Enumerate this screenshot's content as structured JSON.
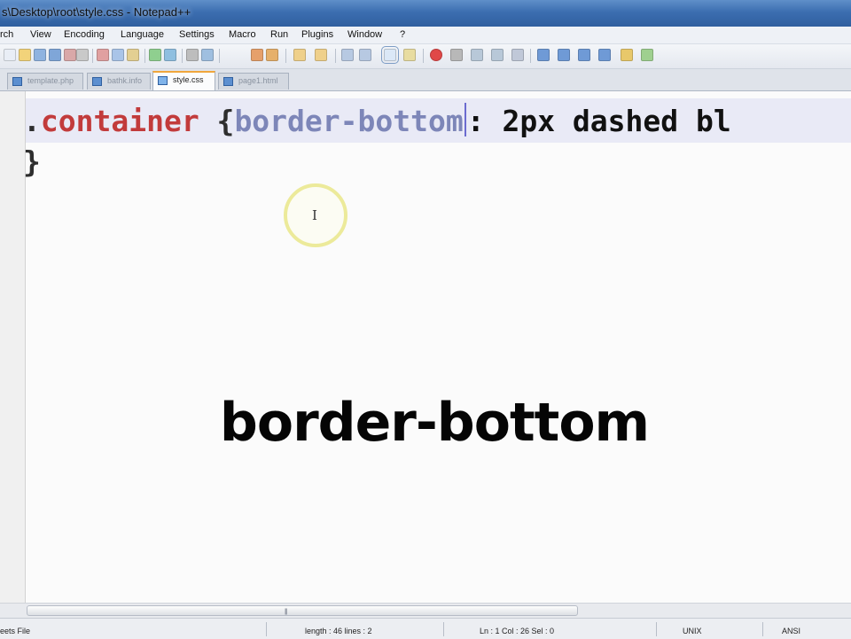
{
  "window": {
    "title": "s\\Desktop\\root\\style.css - Notepad++"
  },
  "menu": [
    "rch",
    "View",
    "Encoding",
    "Language",
    "Settings",
    "Macro",
    "Run",
    "Plugins",
    "Window",
    "?"
  ],
  "toolbar": {
    "icons": [
      "new-file-icon",
      "open-file-icon",
      "save-icon",
      "save-all-icon",
      "close-icon",
      "close-all-icon",
      "print-icon",
      "cut-icon",
      "copy-icon",
      "paste-icon",
      "undo-icon",
      "redo-icon",
      "find-icon",
      "replace-icon",
      "zoom-in-icon",
      "zoom-out-icon",
      "sync-vertical-icon",
      "sync-horizontal-icon",
      "word-wrap-icon",
      "show-all-chars-icon",
      "indent-guide-icon",
      "record-macro-icon",
      "stop-macro-icon",
      "play-macro-icon",
      "play-multiple-icon",
      "save-macro-icon",
      "fold-icon",
      "up-icon",
      "down-icon",
      "unfold-icon",
      "folder-icon",
      "spellcheck-icon"
    ]
  },
  "tabs": [
    {
      "label": "template.php",
      "active": false
    },
    {
      "label": "bathk.info",
      "active": false
    },
    {
      "label": "style.css",
      "active": true
    },
    {
      "label": "page1.html",
      "active": false
    }
  ],
  "editor": {
    "line1": {
      "selector_dot": ".",
      "selector_name": "container",
      "brace_open": " {",
      "property": "border-bottom",
      "rest": ": 2px dashed bl"
    },
    "line2": "}"
  },
  "cursor_glyph": "I",
  "caption": "border-bottom",
  "status": {
    "type": "eets File",
    "length": "length : 46    lines : 2",
    "position": "Ln : 1    Col : 26    Sel : 0",
    "eol": "UNIX",
    "encoding": "ANSI"
  },
  "colors": {
    "selector": "#c23b3b",
    "property": "#7d86b8",
    "value": "#111111",
    "current_line": "#e9eaf6",
    "active_tab_accent": "#f0a73c"
  }
}
